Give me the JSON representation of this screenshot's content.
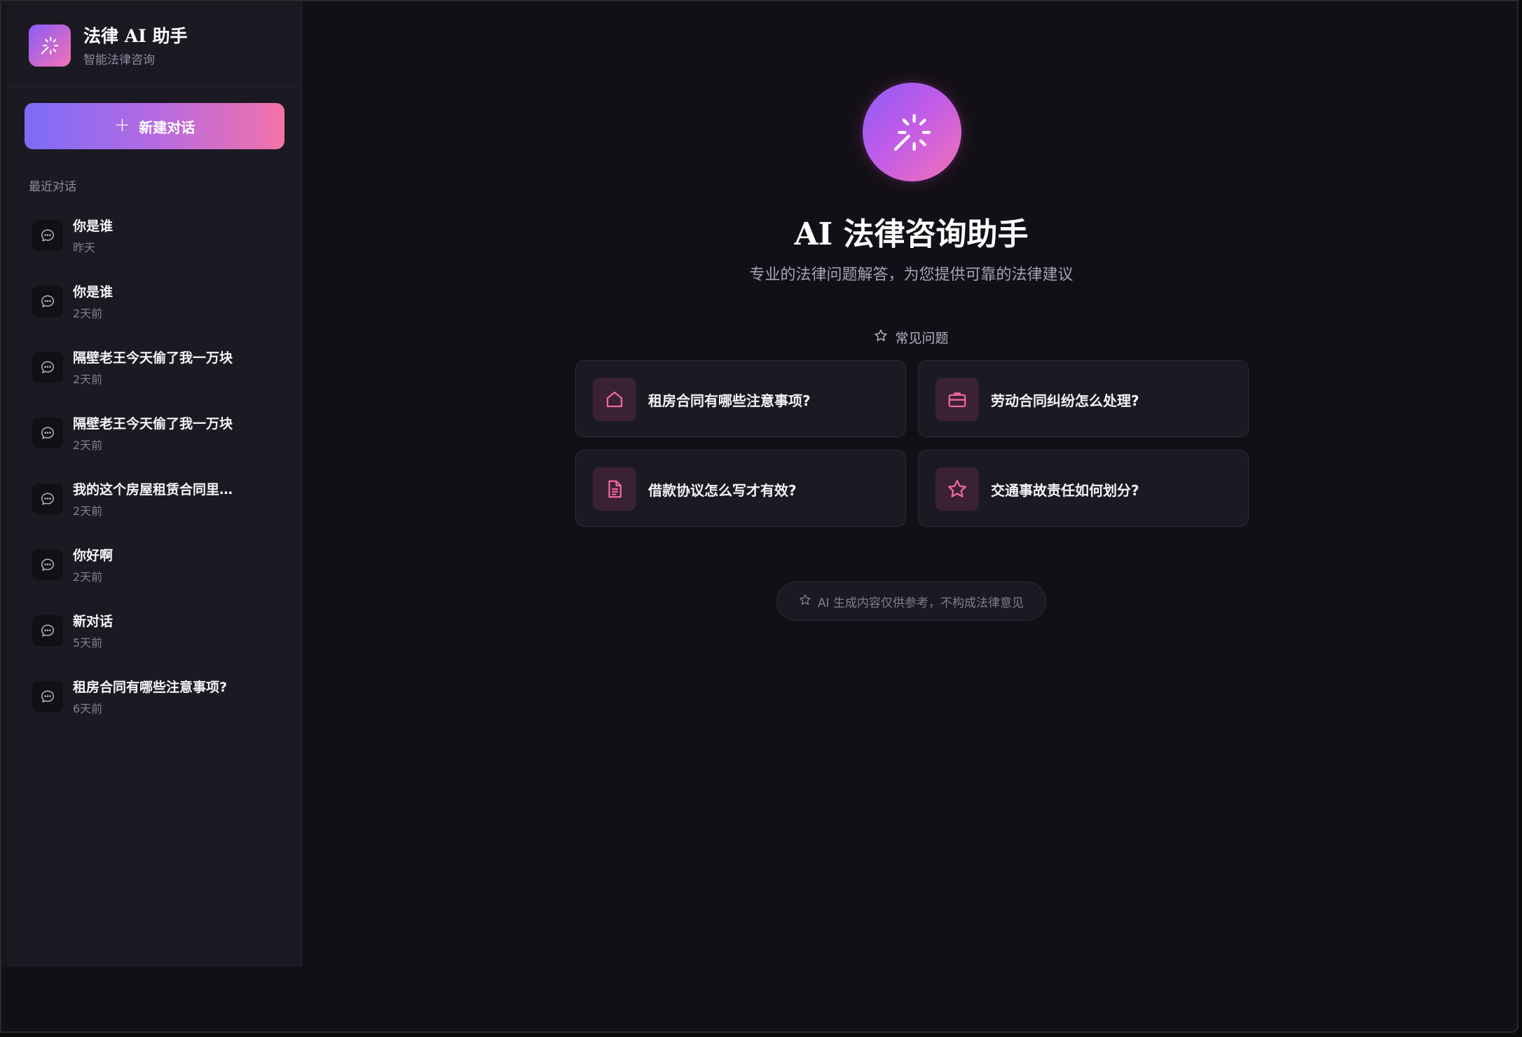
{
  "brand": {
    "title": "法律 AI 助手",
    "subtitle": "智能法律咨询",
    "logo_icon": "sparkle-icon",
    "gradient": [
      "#8b5cf6",
      "#f472b6"
    ]
  },
  "sidebar": {
    "new_chat_label": "新建对话",
    "new_chat_icon": "plus-icon",
    "section_label": "最近对话",
    "conversations": [
      {
        "title": "你是谁",
        "time": "昨天"
      },
      {
        "title": "你是谁",
        "time": "2天前"
      },
      {
        "title": "隔壁老王今天偷了我一万块",
        "time": "2天前"
      },
      {
        "title": "隔壁老王今天偷了我一万块",
        "time": "2天前"
      },
      {
        "title": "我的这个房屋租赁合同里…",
        "time": "2天前"
      },
      {
        "title": "你好啊",
        "time": "2天前"
      },
      {
        "title": "新对话",
        "time": "5天前"
      },
      {
        "title": "租房合同有哪些注意事项?",
        "time": "6天前"
      }
    ],
    "conversation_icon": "chat-bubble-icon"
  },
  "main": {
    "hero_icon": "sparkle-icon",
    "title": "AI 法律咨询助手",
    "subtitle": "专业的法律问题解答，为您提供可靠的法律建议",
    "faq_heading": "常见问题",
    "faq_icon": "star-outline-icon",
    "faq": [
      {
        "text": "租房合同有哪些注意事项?",
        "icon": "house-icon"
      },
      {
        "text": "劳动合同纠纷怎么处理?",
        "icon": "briefcase-icon"
      },
      {
        "text": "借款协议怎么写才有效?",
        "icon": "document-icon"
      },
      {
        "text": "交通事故责任如何划分?",
        "icon": "star-icon"
      }
    ],
    "disclaimer": "AI 生成内容仅供参考，不构成法律意见",
    "disclaimer_icon": "star-outline-icon"
  },
  "colors": {
    "accent_pink": "#f06a9c",
    "accent_purple": "#8b5cf6",
    "background": "#111016",
    "sidebar": "#1b1a22"
  }
}
